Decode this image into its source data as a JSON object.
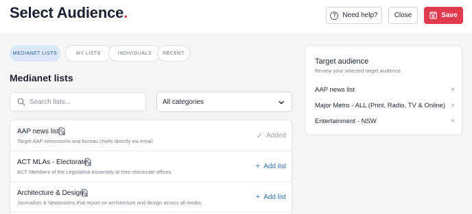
{
  "header": {
    "title": "Select Audience",
    "title_dot": ".",
    "help_label": "Need help?",
    "close_label": "Close",
    "save_label": "Save",
    "accent_color": "#e23b4e"
  },
  "tabs": [
    {
      "label": "MEDIANET LISTS",
      "active": true
    },
    {
      "label": "MY LISTS",
      "active": false
    },
    {
      "label": "INDIVIDUALS",
      "active": false
    },
    {
      "label": "RECENT",
      "active": false
    }
  ],
  "section_title": "Medianet lists",
  "search": {
    "placeholder": "Search lists...",
    "value": ""
  },
  "category_select": {
    "value": "All categories"
  },
  "lists": [
    {
      "name": "AAP news list",
      "description": "Target AAP newsrooms and bureau chiefs directly via email.",
      "action": "Added",
      "action_icon": "✓",
      "status": "added"
    },
    {
      "name": "ACT MLAs - Electorate",
      "description": "ACT Members of the Legislative Assembly at their electorate offices",
      "action": "Add list",
      "action_icon": "+",
      "status": "add"
    },
    {
      "name": "Architecture & Design",
      "description": "Journalists & Newsrooms that report on architecture and design across all media.",
      "action": "Add list",
      "action_icon": "+",
      "status": "add"
    }
  ],
  "target_panel": {
    "title": "Target audience",
    "subtitle": "Review your selected target audience.",
    "items": [
      "AAP news list",
      "Major Metro - ALL (Print, Radio, TV & Online)",
      "Entertainment - NSW"
    ],
    "remove_symbol": "×"
  }
}
